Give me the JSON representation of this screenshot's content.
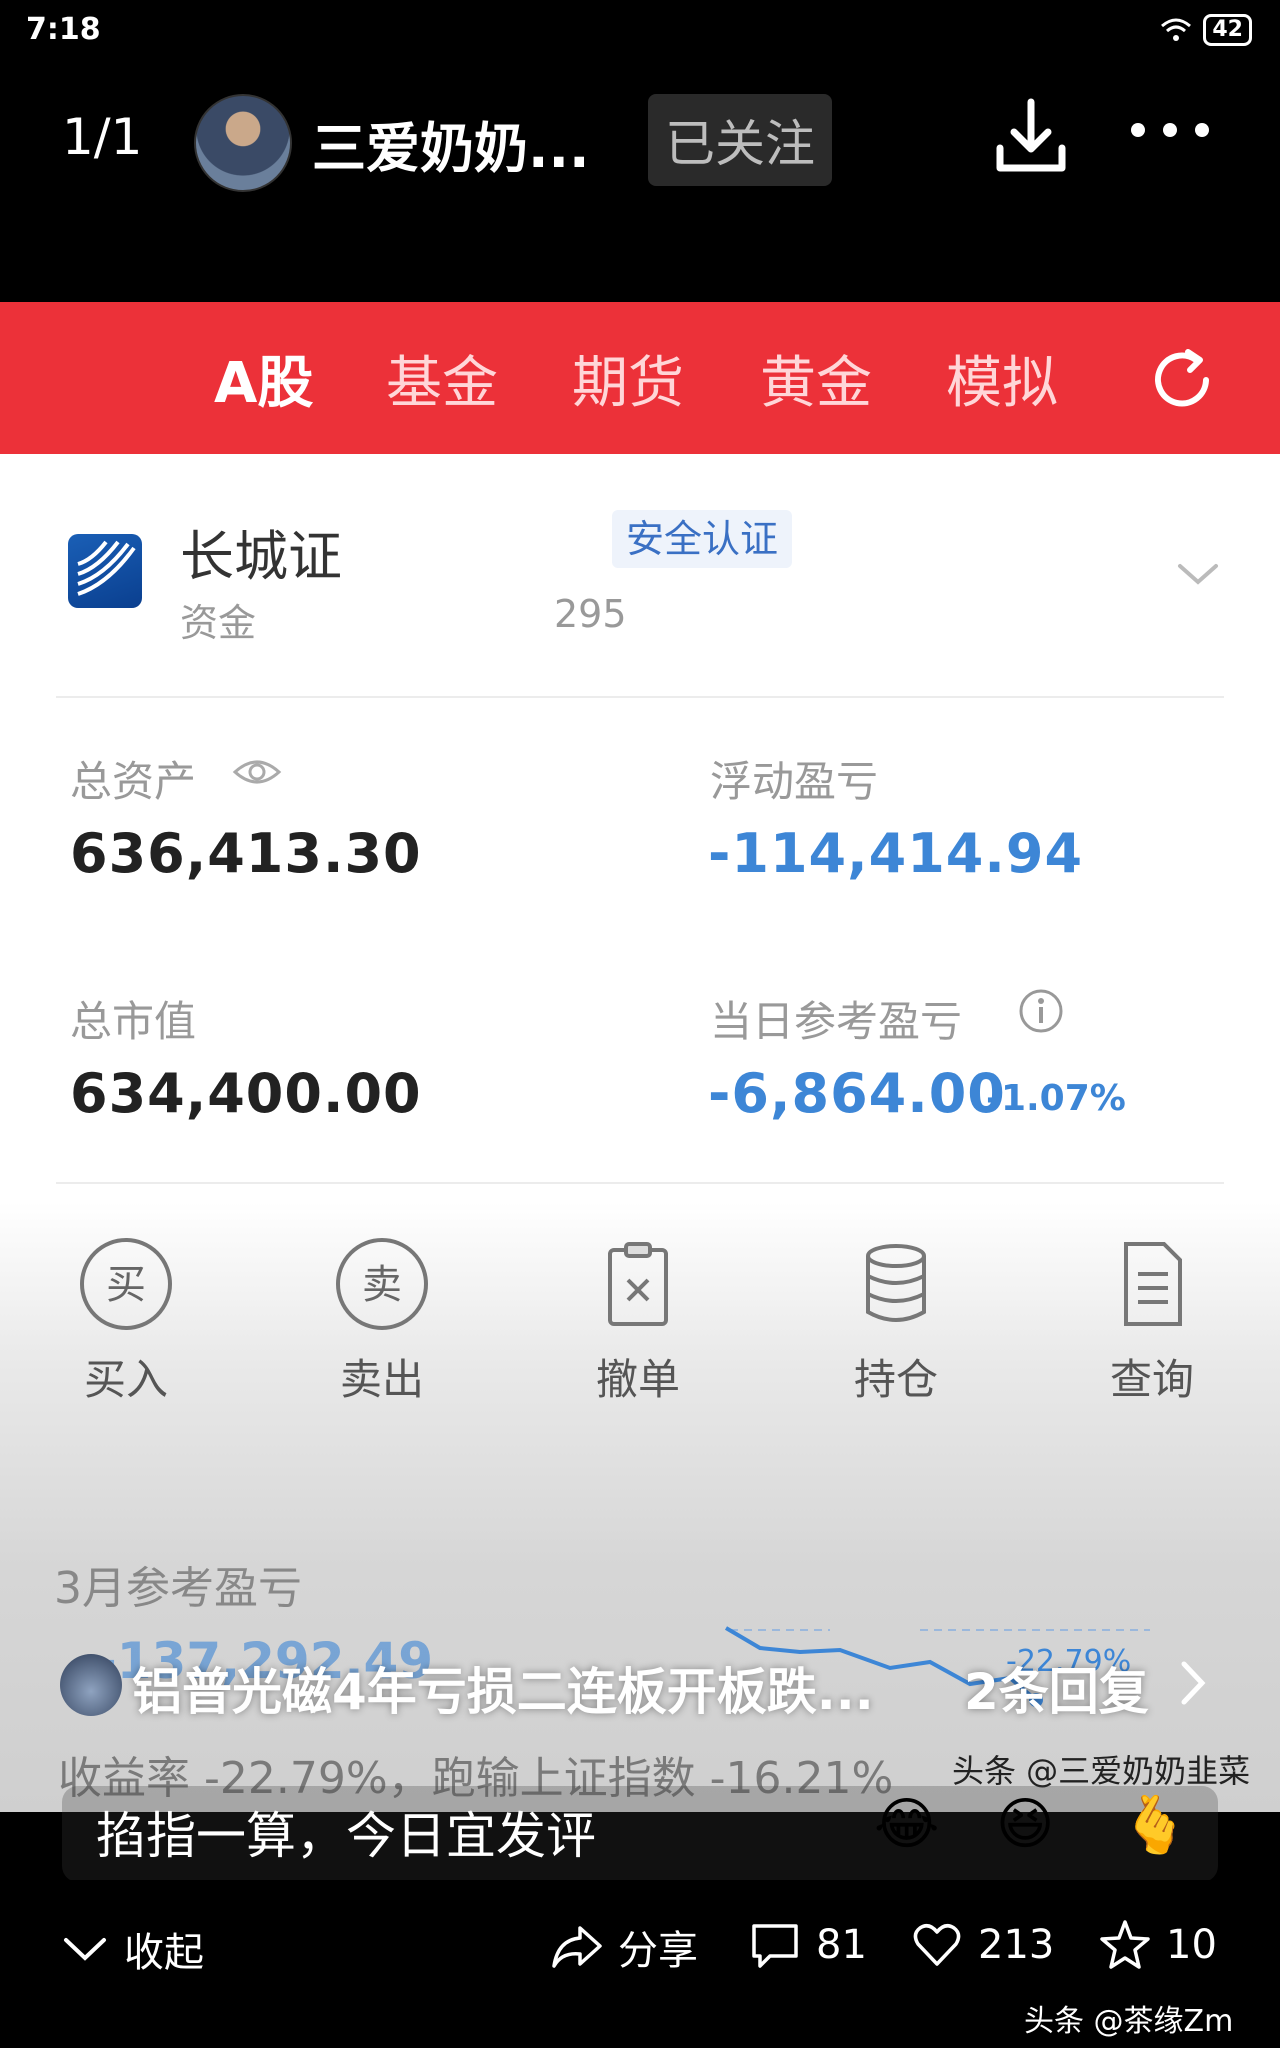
{
  "status": {
    "time": "7:18",
    "wifi_badge": "6",
    "battery": "42"
  },
  "header": {
    "counter": "1/1",
    "author": "三爱奶奶...",
    "follow_label": "已关注"
  },
  "tabs": [
    {
      "label": "A股",
      "active": true
    },
    {
      "label": "基金",
      "active": false
    },
    {
      "label": "期货",
      "active": false
    },
    {
      "label": "黄金",
      "active": false
    },
    {
      "label": "模拟",
      "active": false
    }
  ],
  "broker": {
    "name": "长城证",
    "badge": "安全认证",
    "account_label": "资金",
    "account_suffix": "295"
  },
  "summary": {
    "total_assets_label": "总资产",
    "total_assets": "636,413.30",
    "floating_pl_label": "浮动盈亏",
    "floating_pl": "-114,414.94",
    "market_value_label": "总市值",
    "market_value": "634,400.00",
    "daily_pl_label": "当日参考盈亏",
    "daily_pl": "-6,864.00",
    "daily_pct": "-1.07%"
  },
  "actions": [
    {
      "label": "买入",
      "icon_text": "买"
    },
    {
      "label": "卖出",
      "icon_text": "卖"
    },
    {
      "label": "撤单"
    },
    {
      "label": "持仓"
    },
    {
      "label": "查询"
    }
  ],
  "monthly": {
    "label": "3月参考盈亏",
    "value": "-137,292.49",
    "chart_pct": "-22.79%",
    "return_text": "收益率 -22.79%，跑输上证指数 -16.21%"
  },
  "news": {
    "title": "铝普光磁4年亏损二连板开板跌...",
    "replies": "2条回复"
  },
  "watermark_top": "头条 @三爱奶奶韭菜",
  "comment": {
    "placeholder": "掐指一算，今日宜发评",
    "emojis": [
      "😂",
      "😆",
      "🫰"
    ]
  },
  "bottom": {
    "collapse_label": "收起",
    "share_label": "分享",
    "comments": "81",
    "likes": "213",
    "favorites": "10",
    "watermark": "头条 @茶缘Zm"
  }
}
